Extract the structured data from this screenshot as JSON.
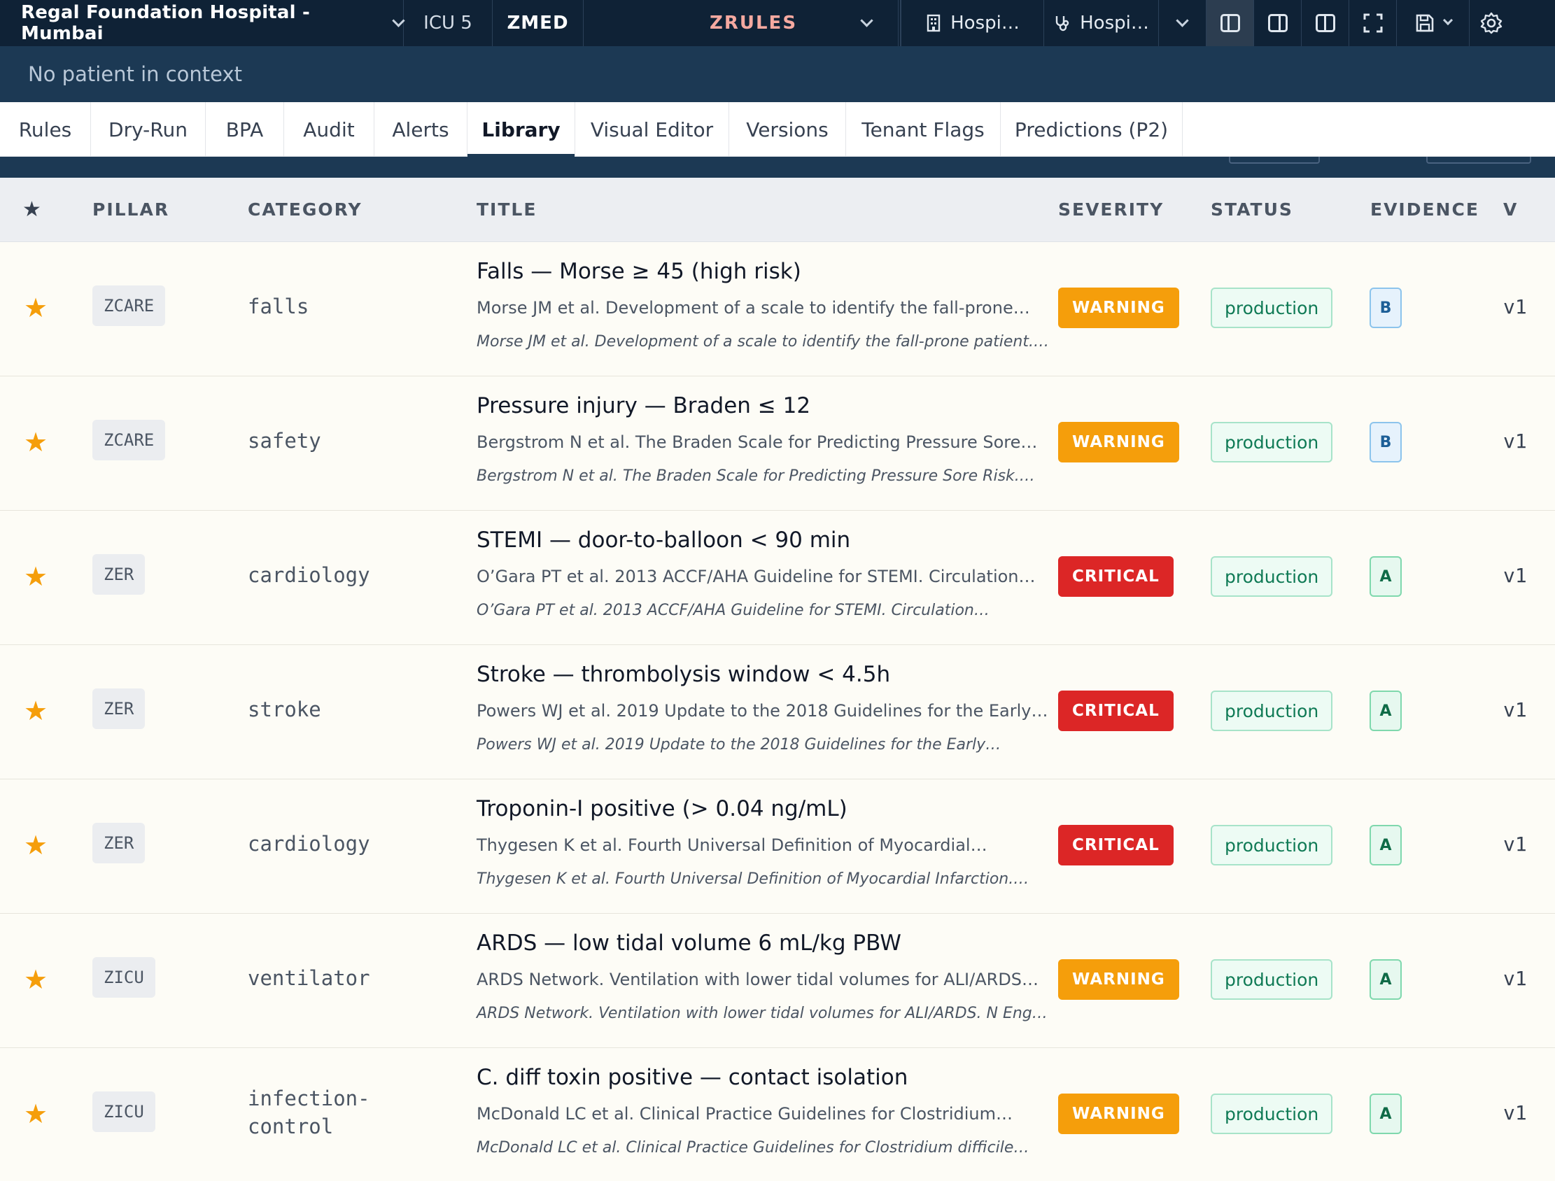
{
  "topbar": {
    "hospital": "Regal Foundation Hospital - Mumbai",
    "unit": "ICU 5",
    "module": "ZMED",
    "product": "ZRULES",
    "tab_a": "Hospi…",
    "tab_b": "Hospi…",
    "icons": [
      "building-icon",
      "stethoscope-icon",
      "chevron-down-icon",
      "panel-left-icon",
      "panel-right-icon",
      "panel-split-icon",
      "fullscreen-icon",
      "save-icon",
      "gear-icon"
    ]
  },
  "context": {
    "text": "No patient in context"
  },
  "tabs": [
    "Rules",
    "Dry-Run",
    "BPA",
    "Audit",
    "Alerts",
    "Library",
    "Visual Editor",
    "Versions",
    "Tenant Flags",
    "Predictions (P2)"
  ],
  "active_tab": "Library",
  "table": {
    "headers": {
      "star": "★",
      "pillar": "PILLAR",
      "category": "CATEGORY",
      "title": "TITLE",
      "severity": "SEVERITY",
      "status": "STATUS",
      "evidence": "EVIDENCE",
      "version": "V"
    },
    "rows": [
      {
        "star": "★",
        "pillar": "ZCARE",
        "category": "falls",
        "title": "Falls — Morse ≥ 45 (high risk)",
        "summary": "Morse JM et al. Development of a scale to identify the fall-prone…",
        "citation": "Morse JM et al. Development of a scale to identify the fall-prone patient.…",
        "severity": "WARNING",
        "status": "production",
        "evidence": "B",
        "version": "v1"
      },
      {
        "star": "★",
        "pillar": "ZCARE",
        "category": "safety",
        "title": "Pressure injury — Braden ≤ 12",
        "summary": "Bergstrom N et al. The Braden Scale for Predicting Pressure Sore…",
        "citation": "Bergstrom N et al. The Braden Scale for Predicting Pressure Sore Risk.…",
        "severity": "WARNING",
        "status": "production",
        "evidence": "B",
        "version": "v1"
      },
      {
        "star": "★",
        "pillar": "ZER",
        "category": "cardiology",
        "title": "STEMI — door-to-balloon < 90 min",
        "summary": "O’Gara PT et al. 2013 ACCF/AHA Guideline for STEMI. Circulation…",
        "citation": "O’Gara PT et al. 2013 ACCF/AHA Guideline for STEMI. Circulation…",
        "severity": "CRITICAL",
        "status": "production",
        "evidence": "A",
        "version": "v1"
      },
      {
        "star": "★",
        "pillar": "ZER",
        "category": "stroke",
        "title": "Stroke — thrombolysis window < 4.5h",
        "summary": "Powers WJ et al. 2019 Update to the 2018 Guidelines for the Early…",
        "citation": "Powers WJ et al. 2019 Update to the 2018 Guidelines for the Early…",
        "severity": "CRITICAL",
        "status": "production",
        "evidence": "A",
        "version": "v1"
      },
      {
        "star": "★",
        "pillar": "ZER",
        "category": "cardiology",
        "title": "Troponin-I positive (> 0.04 ng/mL)",
        "summary": "Thygesen K et al. Fourth Universal Definition of Myocardial…",
        "citation": "Thygesen K et al. Fourth Universal Definition of Myocardial Infarction.…",
        "severity": "CRITICAL",
        "status": "production",
        "evidence": "A",
        "version": "v1"
      },
      {
        "star": "★",
        "pillar": "ZICU",
        "category": "ventilator",
        "title": "ARDS — low tidal volume 6 mL/kg PBW",
        "summary": "ARDS Network. Ventilation with lower tidal volumes for ALI/ARDS…",
        "citation": "ARDS Network. Ventilation with lower tidal volumes for ALI/ARDS. N Eng…",
        "severity": "WARNING",
        "status": "production",
        "evidence": "A",
        "version": "v1"
      },
      {
        "star": "★",
        "pillar": "ZICU",
        "category_lines": [
          "infection-",
          "control"
        ],
        "title": "C. diff toxin positive — contact isolation",
        "summary": "McDonald LC et al. Clinical Practice Guidelines for Clostridium…",
        "citation": "McDonald LC et al. Clinical Practice Guidelines for Clostridium difficile…",
        "severity": "WARNING",
        "status": "production",
        "evidence": "A",
        "version": "v1"
      }
    ]
  }
}
